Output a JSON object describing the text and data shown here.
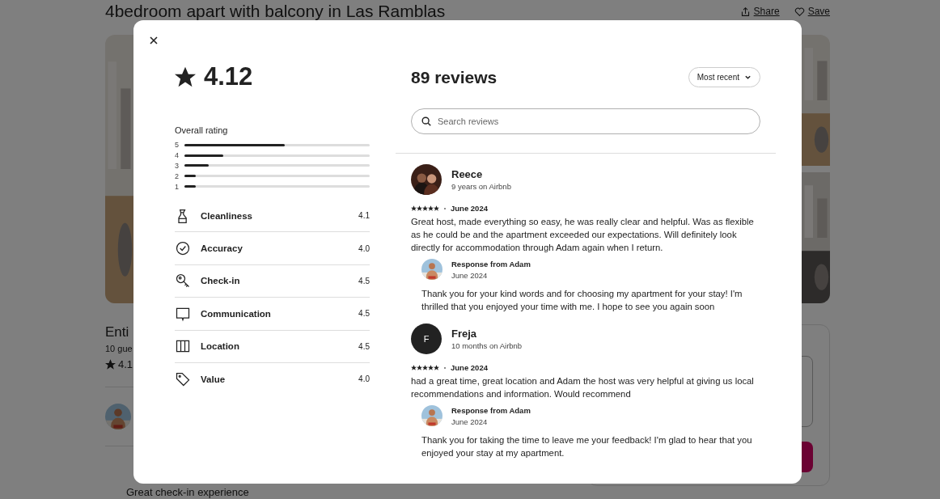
{
  "page": {
    "title": "4bedroom apart with balcony in Las Ramblas",
    "share": "Share",
    "save": "Save",
    "listing_type": "Enti",
    "guests": "10 gue",
    "rating": "4.1",
    "highlight": "Great check-in experience"
  },
  "modal": {
    "rating": "4.12",
    "overall_label": "Overall rating",
    "distribution": [
      {
        "label": "5",
        "level": 0.54
      },
      {
        "label": "4",
        "level": 0.21
      },
      {
        "label": "3",
        "level": 0.13
      },
      {
        "label": "2",
        "level": 0.06
      },
      {
        "label": "1",
        "level": 0.06
      }
    ],
    "categories": [
      {
        "kind": "cleanliness",
        "label": "Cleanliness",
        "score": "4.1"
      },
      {
        "kind": "accuracy",
        "label": "Accuracy",
        "score": "4.0"
      },
      {
        "kind": "checkin",
        "label": "Check-in",
        "score": "4.5"
      },
      {
        "kind": "communication",
        "label": "Communication",
        "score": "4.5"
      },
      {
        "kind": "location",
        "label": "Location",
        "score": "4.5"
      },
      {
        "kind": "value",
        "label": "Value",
        "score": "4.0"
      }
    ],
    "reviews_title": "89 reviews",
    "sort": "Most recent",
    "search": {
      "placeholder": "Search reviews"
    },
    "reviews": [
      {
        "name": "Reece",
        "tenure": "9 years on Airbnb",
        "stars": 5,
        "date": "June 2024",
        "text": "Great host, made everything so easy, he was really clear and helpful. Was as flexible as he could be and the apartment exceeded our expectations. Will definitely look directly for accommodation through Adam again when I return.",
        "response": {
          "title": "Response from Adam",
          "date": "June 2024",
          "text": "Thank you for your kind words and for choosing my apartment for your stay! I'm thrilled that you enjoyed your time with me. I hope to see you again soon"
        }
      },
      {
        "avatar": {
          "kind": "initial",
          "letter": "F"
        },
        "name": "Freja",
        "tenure": "10 months on Airbnb",
        "stars": 5,
        "date": "June 2024",
        "text": "had a great time, great location and Adam the host was very helpful at giving us local recommendations and information. Would recommend",
        "response": {
          "title": "Response from Adam",
          "date": "June 2024",
          "text": "Thank you for taking the time to leave me your feedback! I'm glad to hear that you enjoyed your stay at my apartment."
        }
      }
    ]
  }
}
